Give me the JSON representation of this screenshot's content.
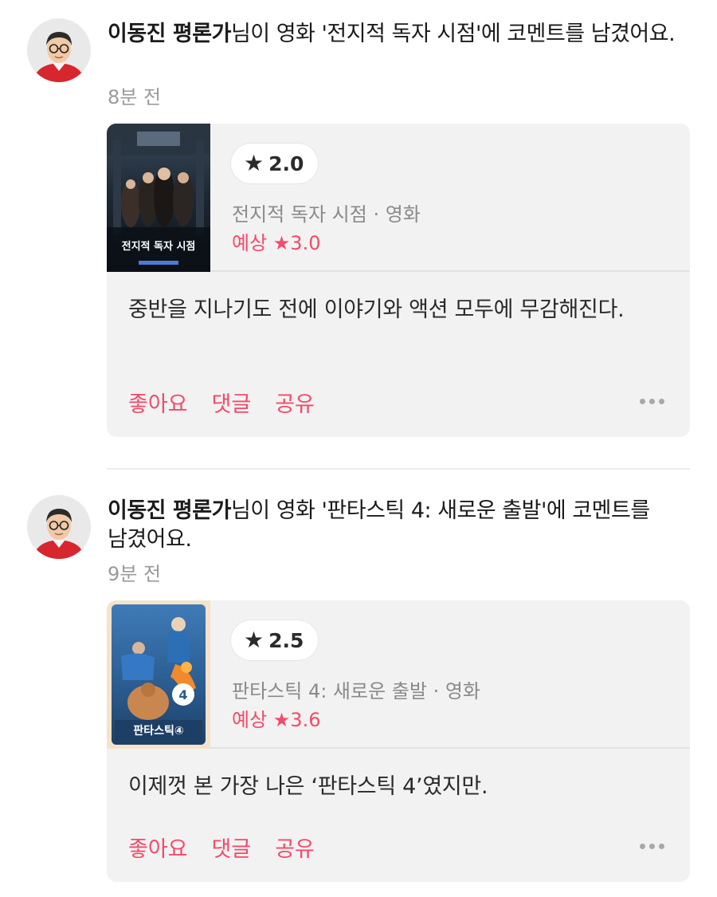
{
  "feed": [
    {
      "critic_name": "이동진 평론가",
      "headline_rest": "님이 영화 '전지적 독자 시점'에 코멘트를 남겼어요.",
      "time": "8분 전",
      "rating_star_icon": "star-icon",
      "rating": "2.0",
      "movie_meta": "전지적 독자 시점 · 영화",
      "expected_label": "예상 ★3.0",
      "poster_title": "전지적 독자 시점",
      "comment": "중반을 지나기도 전에 이야기와 액션 모두에 무감해진다.",
      "actions": {
        "like": "좋아요",
        "comment": "댓글",
        "share": "공유"
      },
      "more_icon": "more-horizontal-icon"
    },
    {
      "critic_name": "이동진 평론가",
      "headline_rest": "님이 영화 '판타스틱 4: 새로운 출발'에 코멘트를 남겼어요.",
      "time": "9분 전",
      "rating_star_icon": "star-icon",
      "rating": "2.5",
      "movie_meta": "판타스틱 4: 새로운 출발 · 영화",
      "expected_label": "예상 ★3.6",
      "poster_title": "판타스틱④",
      "comment": "이제껏 본 가장 나은 ‘판타스틱 4’였지만.",
      "actions": {
        "like": "좋아요",
        "comment": "댓글",
        "share": "공유"
      },
      "more_icon": "more-horizontal-icon"
    }
  ],
  "colors": {
    "accent": "#f24b6a",
    "card_bg": "#f2f2f2",
    "muted_text": "#8a8a8a",
    "timestamp": "#9a9a9a"
  }
}
